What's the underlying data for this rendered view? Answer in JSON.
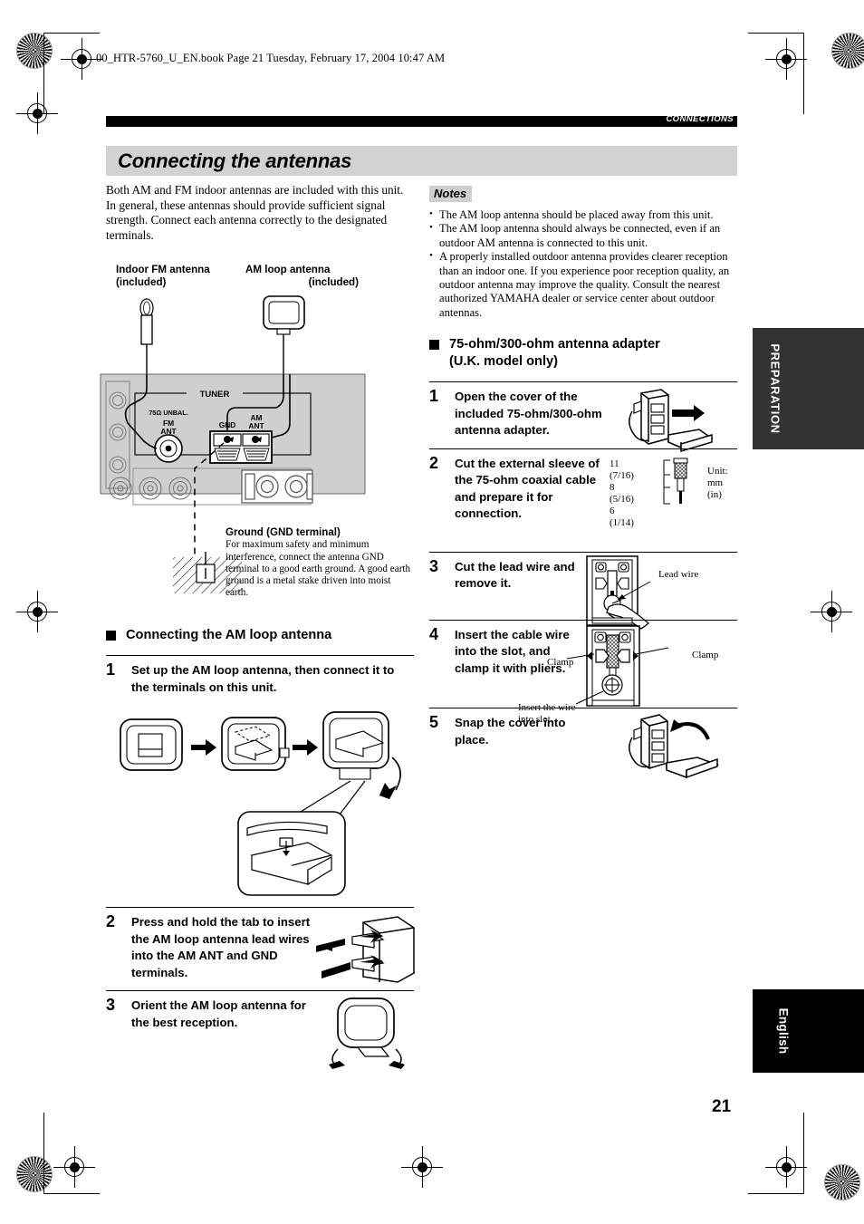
{
  "print": {
    "book_line": "00_HTR-5760_U_EN.book  Page 21  Tuesday, February 17, 2004  10:47 AM"
  },
  "running_head": {
    "label": "CONNECTIONS"
  },
  "page_title": "Connecting the antennas",
  "intro_paragraph": "Both AM and FM indoor antennas are included with this unit. In general, these antennas should provide sufficient signal strength. Connect each antenna correctly to the designated terminals.",
  "notes": {
    "label": "Notes",
    "items": [
      "The AM loop antenna should be placed away from this unit.",
      "The AM loop antenna should always be connected, even if an outdoor AM antenna is connected to this unit.",
      "A properly installed outdoor antenna provides clearer reception than an indoor one. If you experience poor reception quality, an outdoor antenna may improve the quality. Consult the nearest authorized YAMAHA dealer or service center about outdoor antennas."
    ]
  },
  "antenna_diagram": {
    "label_fm": "Indoor FM antenna\n(included)",
    "label_fm_line1": "Indoor FM antenna",
    "label_fm_line2": "(included)",
    "label_am_line1": "AM loop antenna",
    "label_am_line2": "(included)",
    "panel_group": "TUNER",
    "jack_impedance": "75Ω UNBAL.",
    "jack_fm_line1": "FM",
    "jack_fm_line2": "ANT",
    "terminal_gnd": "GND",
    "terminal_am_line1": "AM",
    "terminal_am_line2": "ANT"
  },
  "ground_callout": {
    "title": "Ground (GND terminal)",
    "body": "For maximum safety and minimum interference, connect the antenna GND terminal to a good earth ground. A good earth ground is a metal stake driven into moist earth."
  },
  "section_am_loop": {
    "heading": "Connecting the AM loop antenna",
    "steps": [
      {
        "num": "1",
        "text": "Set up the AM loop antenna, then connect it to the terminals on this unit."
      },
      {
        "num": "2",
        "text": "Press and hold the tab to insert the AM loop antenna lead wires into the AM ANT and GND terminals."
      },
      {
        "num": "3",
        "text": "Orient the AM loop antenna for the best reception."
      }
    ]
  },
  "section_adapter": {
    "heading_line1": "75-ohm/300-ohm antenna adapter",
    "heading_line2": "(U.K. model only)",
    "steps": [
      {
        "num": "1",
        "text": "Open the cover of the included 75-ohm/300-ohm antenna adapter."
      },
      {
        "num": "2",
        "text": "Cut the external sleeve of the 75-ohm coaxial cable and prepare it for connection."
      },
      {
        "num": "3",
        "text": "Cut the lead wire and remove it."
      },
      {
        "num": "4",
        "text": "Insert the cable wire into the slot, and clamp it with pliers."
      },
      {
        "num": "5",
        "text": "Snap the cover into place."
      }
    ],
    "measurements": {
      "m1": "11 (7/16)",
      "m2": "8 (5/16)",
      "m3": "6 (1/14)",
      "unit_line1": "Unit:",
      "unit_line2": "mm (in)"
    },
    "labels": {
      "lead_wire": "Lead wire",
      "clamp_left": "Clamp",
      "clamp_right": "Clamp",
      "insert_line1": "Insert the wire",
      "insert_line2": "into slot."
    }
  },
  "side_tabs": {
    "preparation": "PREPARATION",
    "english": "English"
  },
  "page_number": "21"
}
